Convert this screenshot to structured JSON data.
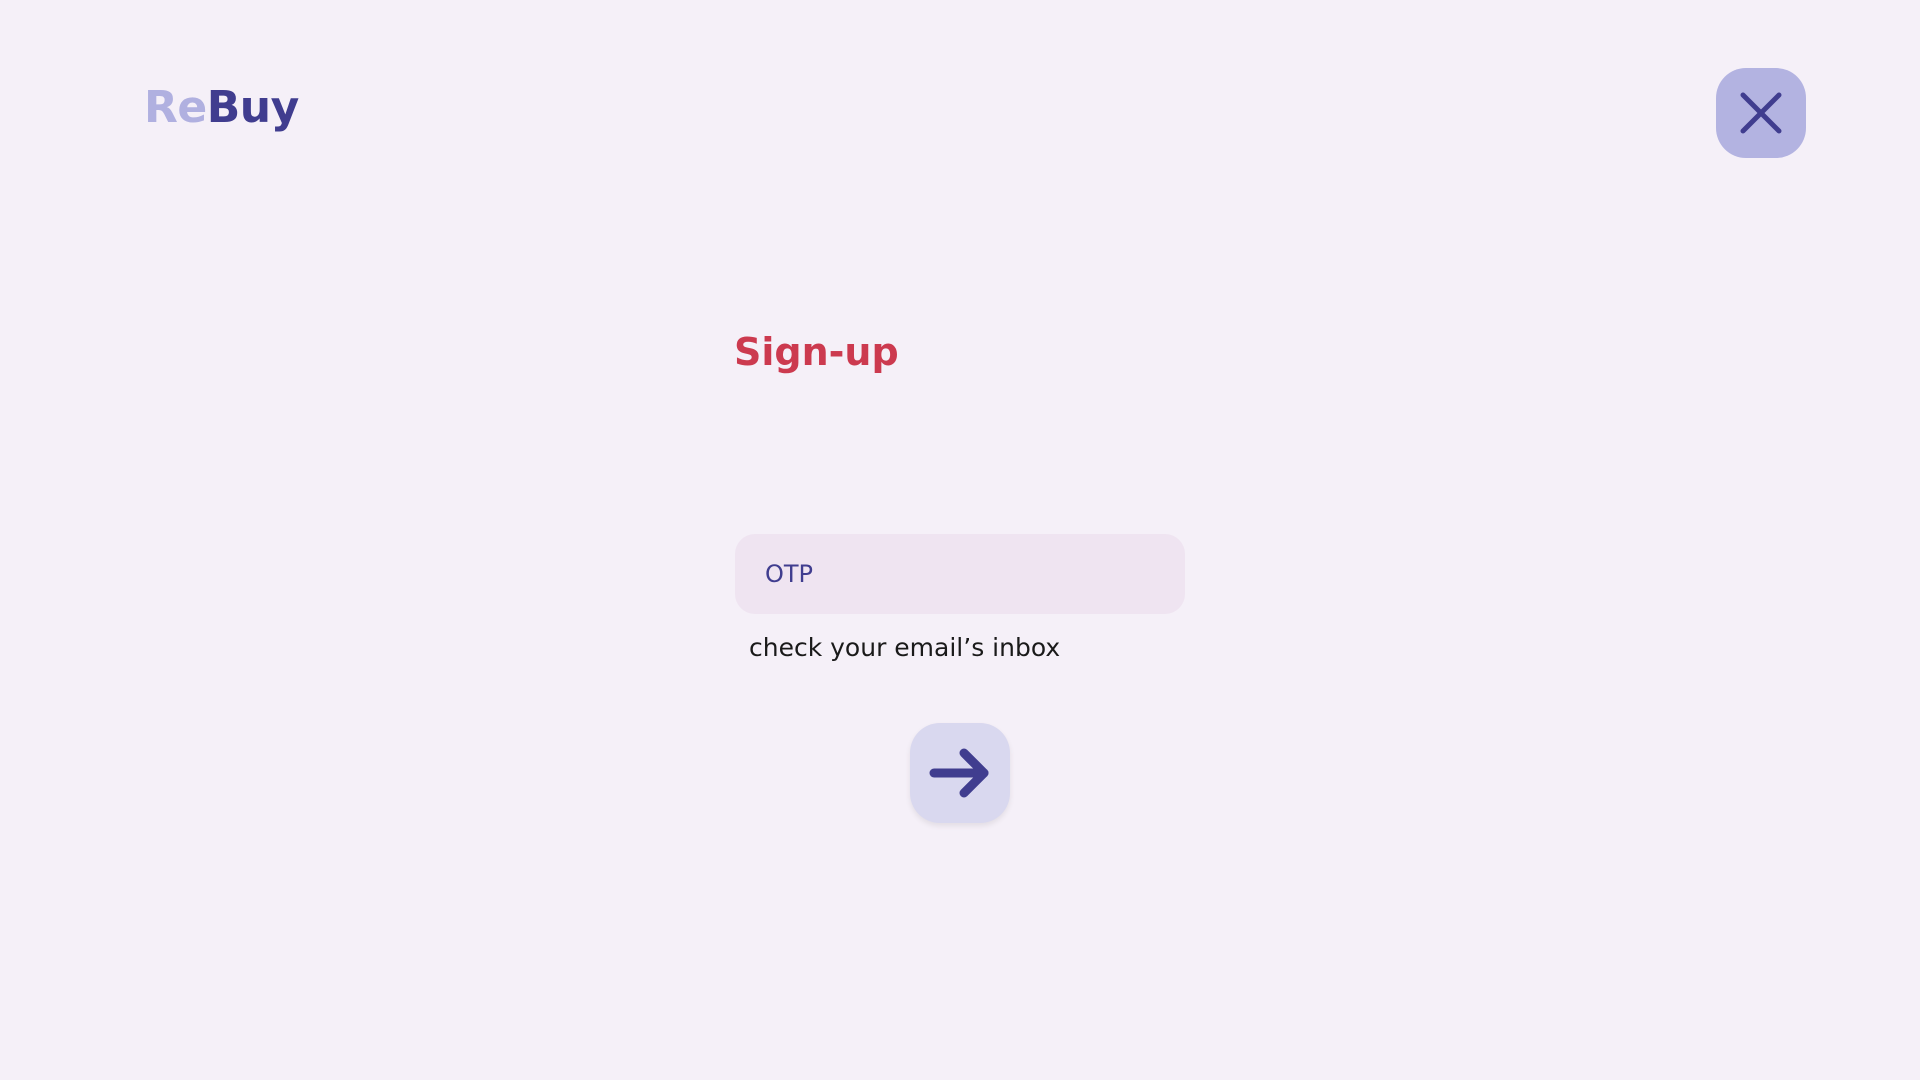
{
  "brand": {
    "prefix": "Re",
    "suffix": "Buy"
  },
  "header": {
    "close_icon": "close-icon"
  },
  "form": {
    "title": "Sign-up",
    "otp_placeholder": "OTP",
    "otp_value": "",
    "hint": "check your email’s inbox",
    "submit_icon": "arrow-right-icon"
  },
  "colors": {
    "background": "#f5f0f8",
    "brand_light": "#b0b0e0",
    "brand_dark": "#403d8f",
    "title": "#cc3a4f",
    "close_button_bg": "#b3b3e1",
    "input_bg": "#efe4f1",
    "submit_button_bg": "#d9d8ef"
  }
}
